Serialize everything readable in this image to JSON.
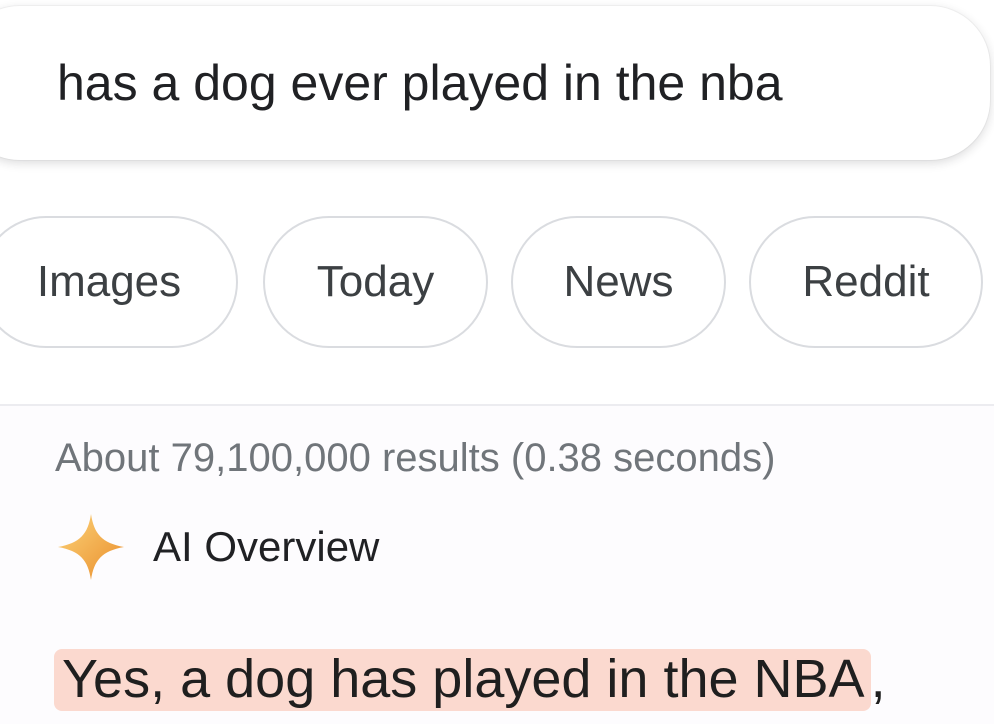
{
  "search": {
    "query": "has a dog ever played in the nba"
  },
  "filters": {
    "chips": [
      "Images",
      "Today",
      "News",
      "Reddit"
    ]
  },
  "results": {
    "stats": "About 79,100,000 results (0.38 seconds)"
  },
  "ai_overview": {
    "icon": "sparkle-icon",
    "title": "AI Overview",
    "answer_highlight": "Yes, a dog has played in the NBA",
    "answer_tail": ","
  },
  "colors": {
    "sparkle_light": "#fcd47a",
    "sparkle_dark": "#e98c2a",
    "highlight": "#fbd9cf"
  }
}
